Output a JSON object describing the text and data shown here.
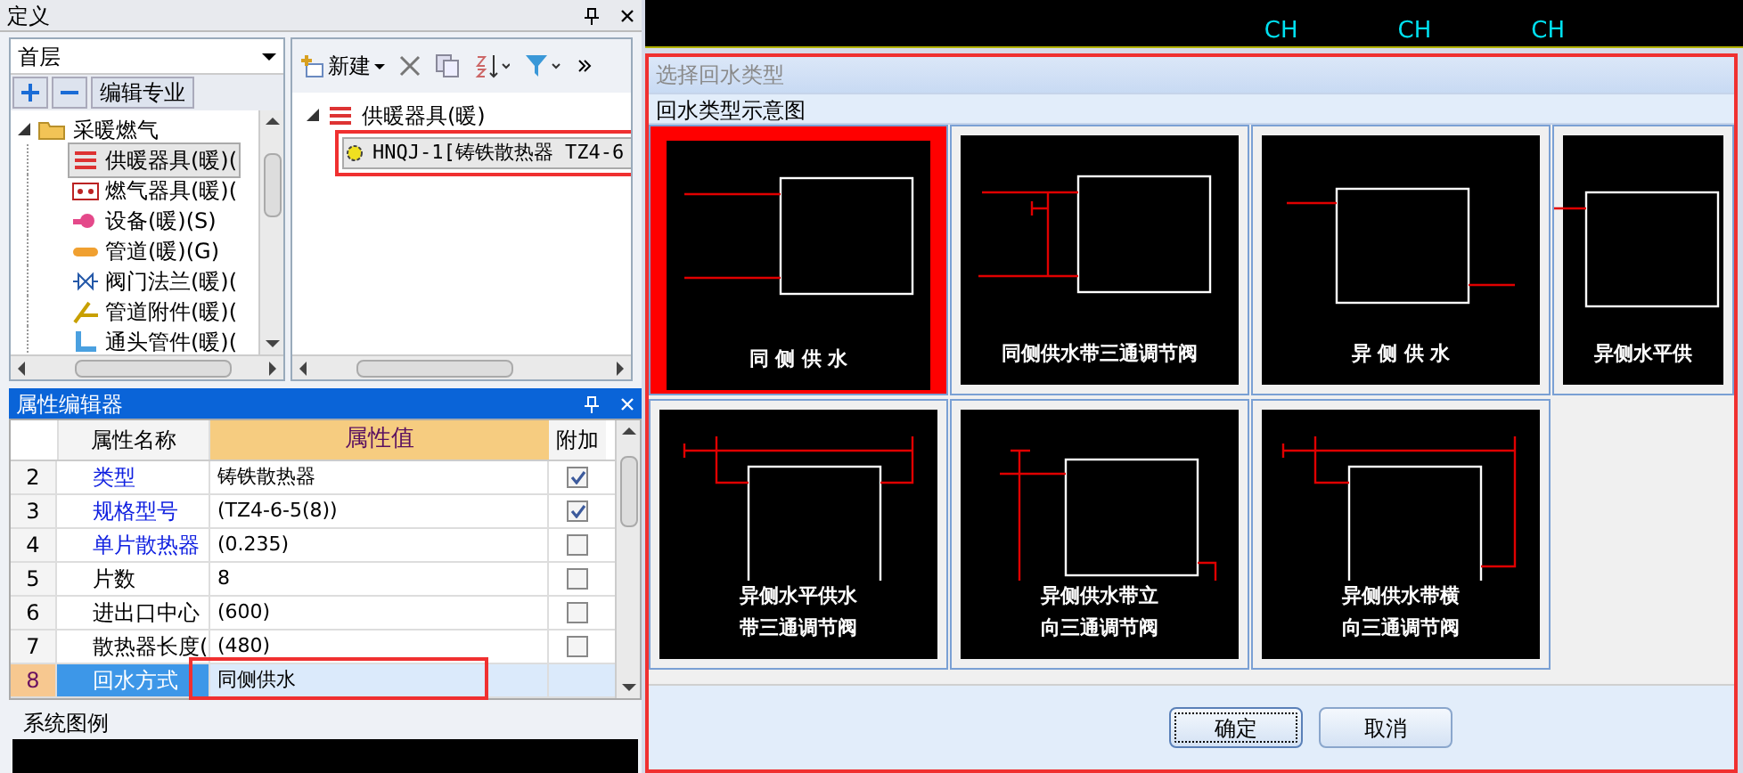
{
  "definition_panel": {
    "title": "定义",
    "floor_select": {
      "value": "首层"
    },
    "edit_button": "编辑专业",
    "tree": {
      "label": "采暖燃气",
      "expanded": true,
      "children": [
        {
          "label": "供暖器具(暖)(",
          "selected": true,
          "kind": "radiator"
        },
        {
          "label": "燃气器具(暖)(",
          "selected": false,
          "kind": "gas"
        },
        {
          "label": "设备(暖)(S)",
          "selected": false,
          "kind": "equipment"
        },
        {
          "label": "管道(暖)(G)",
          "selected": false,
          "kind": "pipe"
        },
        {
          "label": "阀门法兰(暖)(",
          "selected": false,
          "kind": "valve"
        },
        {
          "label": "管道附件(暖)(",
          "selected": false,
          "kind": "fitting"
        },
        {
          "label": "通头管件(暖)(",
          "selected": false,
          "kind": "elbow"
        }
      ]
    }
  },
  "component_panel": {
    "toolbar": {
      "new_button": "新建"
    },
    "tree": {
      "label": "供暖器具(暖)",
      "expanded": true,
      "children": [
        {
          "label": "HNQJ-1[铸铁散热器 TZ4-6",
          "selected": true
        }
      ]
    }
  },
  "property_editor": {
    "title": "属性编辑器",
    "columns": [
      "属性名称",
      "属性值",
      "附加"
    ],
    "rows": [
      {
        "index": "2",
        "name": "类型",
        "public": true,
        "value": "铸铁散热器",
        "checked": true,
        "selected": false
      },
      {
        "index": "3",
        "name": "规格型号",
        "public": true,
        "value": "(TZ4-6-5(8))",
        "checked": true,
        "selected": false
      },
      {
        "index": "4",
        "name": "单片散热器",
        "public": true,
        "value": "(0.235)",
        "checked": false,
        "selected": false
      },
      {
        "index": "5",
        "name": "片数",
        "public": false,
        "value": "8",
        "checked": false,
        "selected": false
      },
      {
        "index": "6",
        "name": "进出口中心",
        "public": false,
        "value": "(600)",
        "checked": false,
        "selected": false
      },
      {
        "index": "7",
        "name": "散热器长度(",
        "public": false,
        "value": "(480)",
        "checked": false,
        "selected": false
      },
      {
        "index": "8",
        "name": "回水方式",
        "public": false,
        "value": "同侧供水",
        "selected": true
      }
    ]
  },
  "legend_panel": {
    "title": "系统图例"
  },
  "cad_strip": {
    "labels": [
      "CH",
      "CH",
      "CH"
    ]
  },
  "dialog": {
    "title": "选择回水类型",
    "group_label": "回水类型示意图",
    "options": [
      {
        "kind": "same-side",
        "lines": [
          "同 侧 供 水"
        ],
        "selected": true
      },
      {
        "kind": "same-side-valve",
        "lines": [
          "同侧供水带三通调节阀"
        ],
        "selected": false
      },
      {
        "kind": "opposite-side",
        "lines": [
          "异 侧 供 水"
        ],
        "selected": false
      },
      {
        "kind": "opposite-horizontal",
        "lines": [
          "异侧水平供"
        ],
        "selected": false
      },
      {
        "kind": "opposite-horizontal-valve",
        "lines": [
          "异侧水平供水",
          "带三通调节阀"
        ],
        "selected": false
      },
      {
        "kind": "opposite-vertical-valve",
        "lines": [
          "异侧供水带立",
          "向三通调节阀"
        ],
        "selected": false
      },
      {
        "kind": "opposite-transverse-valve",
        "lines": [
          "异侧供水带横",
          "向三通调节阀"
        ],
        "selected": false
      }
    ],
    "buttons": [
      {
        "label": "确定",
        "default": true
      },
      {
        "label": "取消",
        "default": false
      }
    ]
  }
}
